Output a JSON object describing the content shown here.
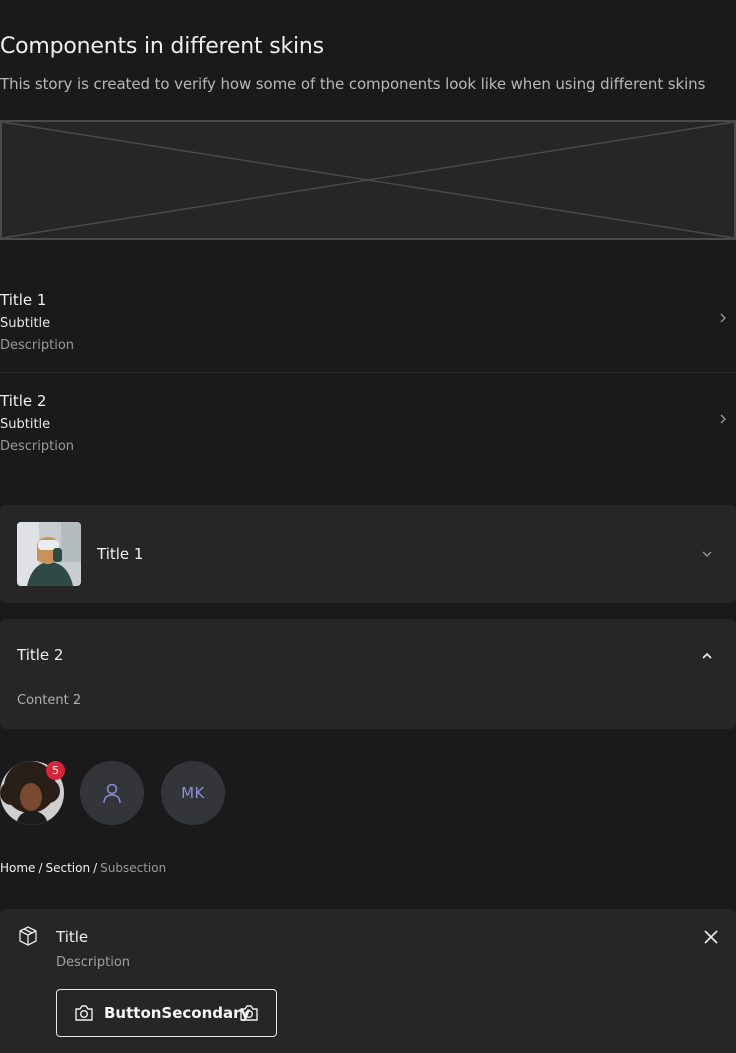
{
  "heading": "Components in different skins",
  "intro": "This story is created to verify how some of the components look like when using different skins",
  "rows": [
    {
      "title": "Title 1",
      "subtitle": "Subtitle",
      "description": "Description"
    },
    {
      "title": "Title 2",
      "subtitle": "Subtitle",
      "description": "Description"
    }
  ],
  "accordions": [
    {
      "title": "Title 1",
      "expanded": false
    },
    {
      "title": "Title 2",
      "expanded": true,
      "content": "Content 2"
    }
  ],
  "avatars": {
    "badge_count": "5",
    "initials": "MK"
  },
  "breadcrumb": {
    "items": [
      "Home",
      "Section"
    ],
    "current": "Subsection",
    "separator": "/"
  },
  "callout": {
    "title": "Title",
    "description": "Description",
    "button_label": "ButtonSecondary"
  },
  "colors": {
    "background": "#1a1a1b",
    "surface": "#262627",
    "badge": "#d6263a",
    "initials_text": "#8c90d8"
  }
}
